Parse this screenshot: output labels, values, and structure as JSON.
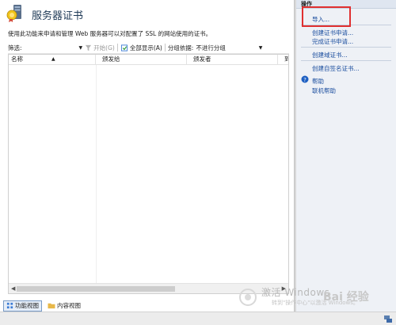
{
  "header": {
    "title": "服务器证书",
    "description": "使用此功能来申请和管理 Web 服务器可以对配置了 SSL 的网站使用的证书。"
  },
  "toolbar": {
    "filter_label": "筛选:",
    "go_label": "开始(G)",
    "show_all_label": "全部显示(A)",
    "group_label": "分组依据:",
    "group_value": "不进行分组"
  },
  "table": {
    "columns": [
      "名称",
      "颁发给",
      "颁发者",
      "到"
    ],
    "rows": []
  },
  "views": {
    "features": "功能视图",
    "content": "内容视图"
  },
  "actions": {
    "header": "操作",
    "import": "导入...",
    "create_request": "创建证书申请...",
    "complete_request": "完成证书申请...",
    "create_domain": "创建域证书...",
    "create_self_signed": "创建自签名证书...",
    "help": "帮助",
    "online_help": "联机帮助"
  },
  "watermark": {
    "line1": "激活 Windows",
    "line2": "转到\"操作中心\"以激活 Windows。",
    "baidu": "Bai 经验"
  },
  "colors": {
    "link": "#1a4d9e",
    "highlight_box": "#e03030",
    "actions_bg": "#eef1f6"
  }
}
